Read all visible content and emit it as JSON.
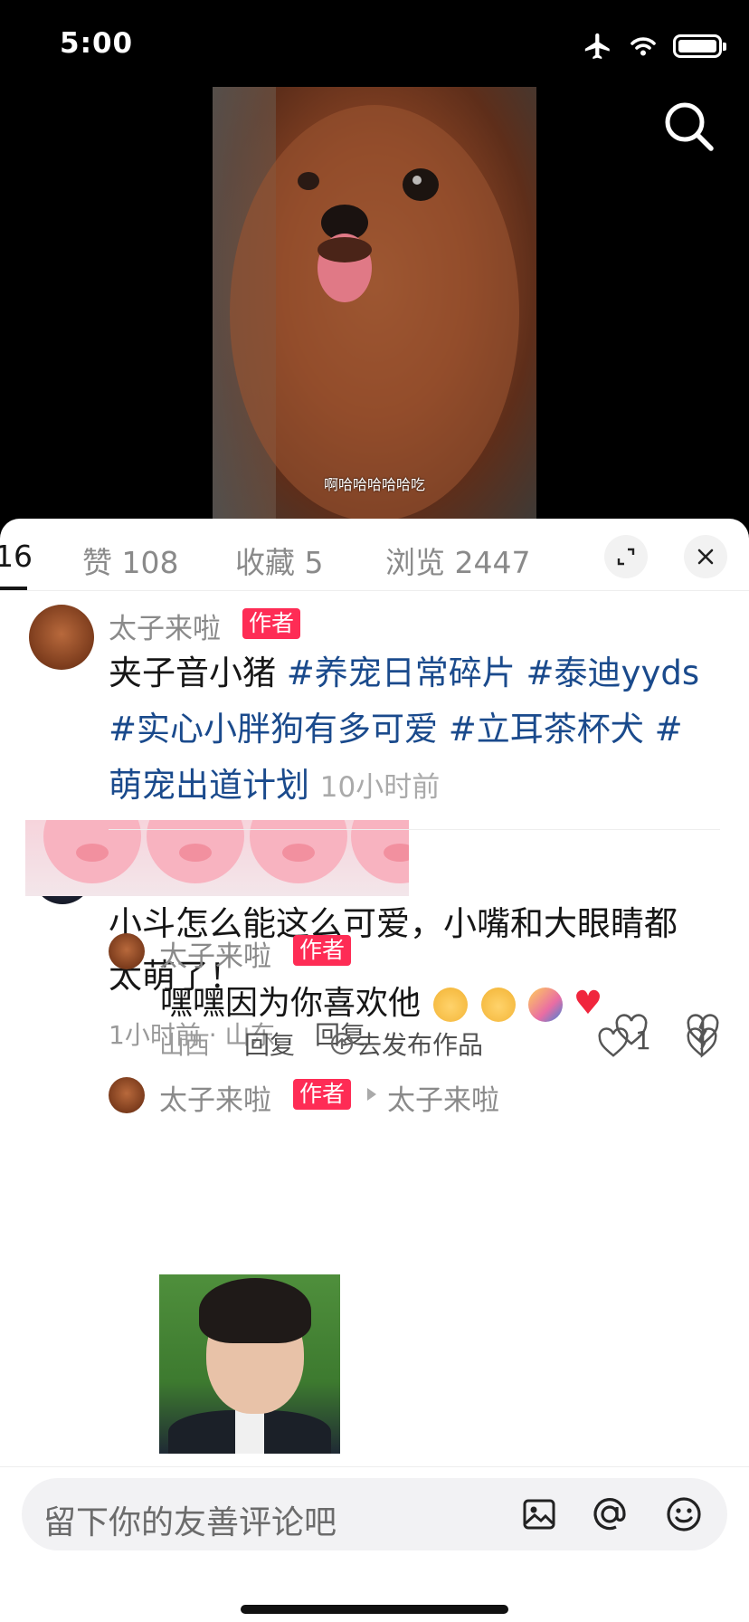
{
  "status_bar": {
    "time": "5:00"
  },
  "video": {
    "caption": "啊哈哈哈哈哈吃"
  },
  "tabs": {
    "comments": "16",
    "likes": "赞 108",
    "favorites": "收藏 5",
    "views": "浏览 2447"
  },
  "post": {
    "author": "太子来啦",
    "badge": "作者",
    "text": "夹子音小猪 ",
    "tags": [
      "#养宠日常碎片",
      "#泰迪yyds",
      "#实心小胖狗有多可爱",
      "#立耳茶杯犬",
      "#萌宠出道计划"
    ],
    "time": "10小时前"
  },
  "comment": {
    "text": "小斗怎么能这么可爱，小嘴和大眼睛都太萌了！",
    "meta": "1小时前 · 山东",
    "reply_label": "回复"
  },
  "reply1": {
    "author": "太子来啦",
    "badge": "作者",
    "text": "嘿嘿因为你喜欢他",
    "location": "山西",
    "reply_label": "回复",
    "publish_label": "去发布作品",
    "like_count": "1"
  },
  "reply2": {
    "author": "太子来啦",
    "badge": "作者",
    "reply_to": "太子来啦"
  },
  "input": {
    "placeholder": "留下你的友善评论吧"
  },
  "colors": {
    "accent": "#fe2c55",
    "tag": "#1a4a8c"
  }
}
